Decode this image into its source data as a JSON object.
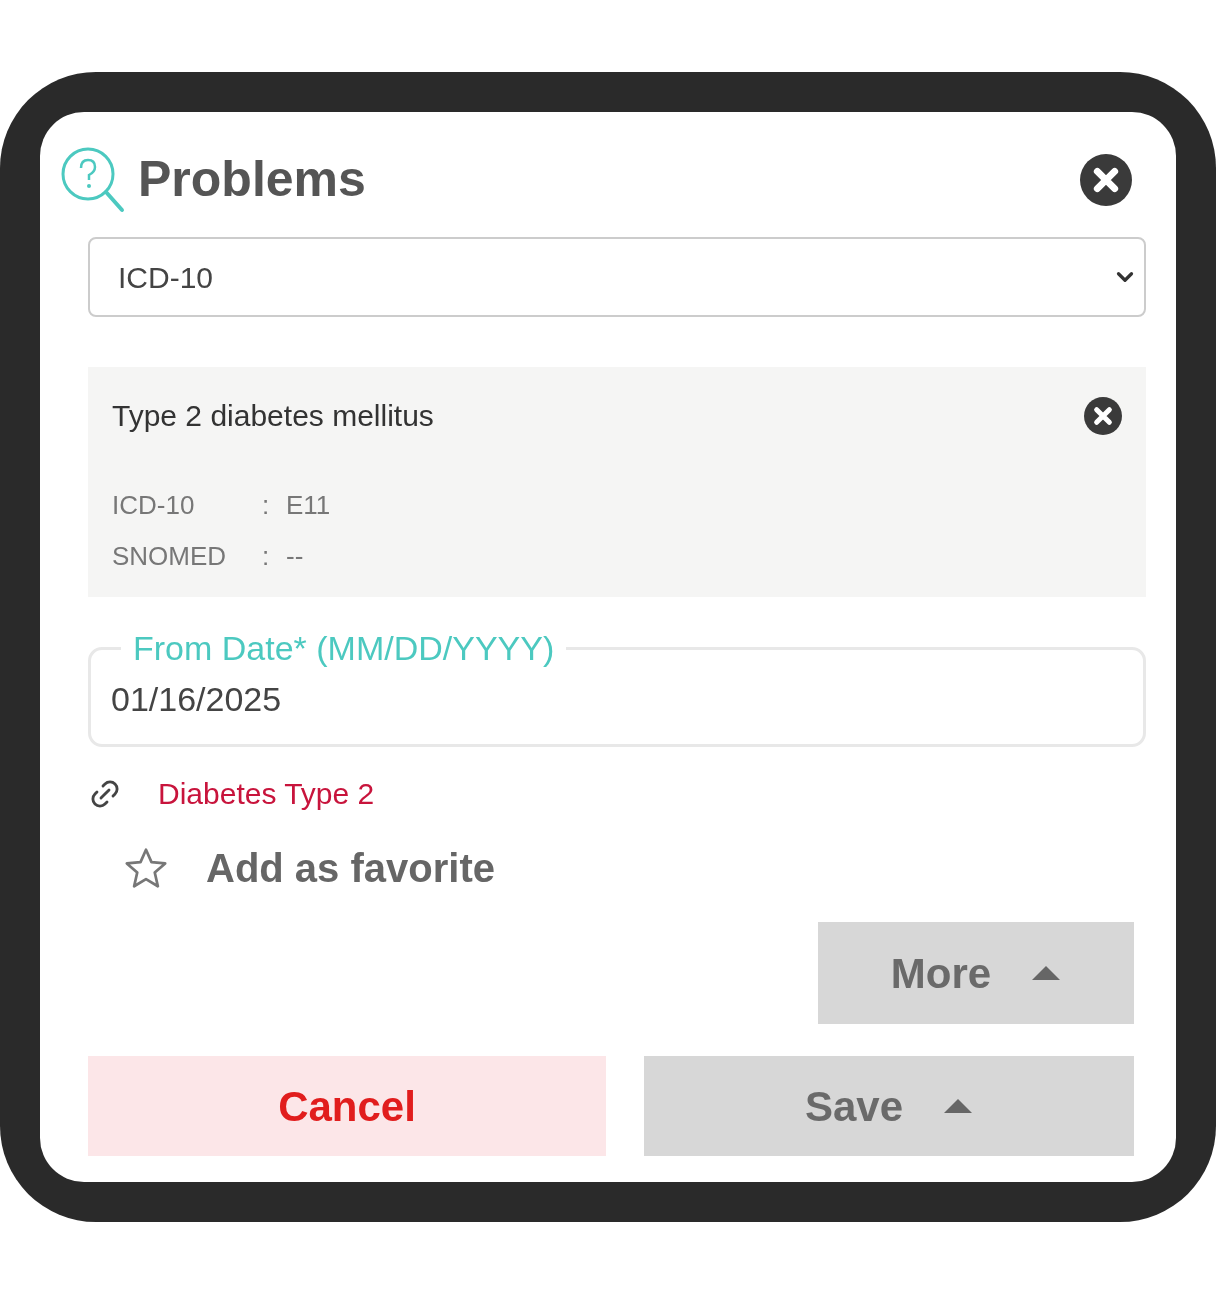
{
  "dialog": {
    "title": "Problems"
  },
  "code_system_select": {
    "value": "ICD-10"
  },
  "selected_problem": {
    "name": "Type 2 diabetes mellitus",
    "codes": [
      {
        "system": "ICD-10",
        "separator": ":",
        "code": "E11"
      },
      {
        "system": "SNOMED",
        "separator": ":",
        "code": "--"
      }
    ]
  },
  "from_date": {
    "label": "From Date* (MM/DD/YYYY)",
    "value": "01/16/2025"
  },
  "linked_problem": "Diabetes Type 2",
  "favorite": {
    "label": "Add as favorite",
    "checked": false
  },
  "more_button": {
    "label": "More"
  },
  "buttons": [
    {
      "kind": "cancel",
      "label": "Cancel"
    },
    {
      "kind": "save",
      "label": "Save"
    }
  ]
}
